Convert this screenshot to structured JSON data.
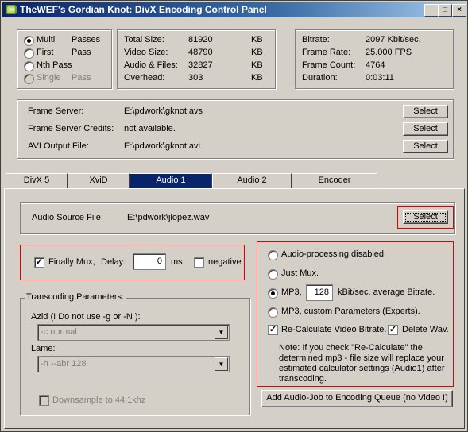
{
  "window": {
    "title": "TheWEF's Gordian Knot:  DivX Encoding Control Panel"
  },
  "passes": {
    "items": [
      {
        "label_a": "Multi",
        "label_b": "Passes",
        "checked": true,
        "enabled": true
      },
      {
        "label_a": "First",
        "label_b": "Pass",
        "checked": false,
        "enabled": true
      },
      {
        "label_a": "Nth Pass",
        "label_b": "",
        "checked": false,
        "enabled": true
      },
      {
        "label_a": "Single",
        "label_b": "Pass",
        "checked": false,
        "enabled": false
      }
    ]
  },
  "sizes": {
    "rows": [
      {
        "label": "Total Size:",
        "value": "81920",
        "unit": "KB"
      },
      {
        "label": "Video Size:",
        "value": "48790",
        "unit": "KB"
      },
      {
        "label": "Audio & Files:",
        "value": "32827",
        "unit": "KB"
      },
      {
        "label": "Overhead:",
        "value": "303",
        "unit": "KB"
      }
    ]
  },
  "stats": {
    "rows": [
      {
        "label": "Bitrate:",
        "value": "2097 Kbit/sec."
      },
      {
        "label": "Frame Rate:",
        "value": "25.000 FPS"
      },
      {
        "label": "Frame Count:",
        "value": "4764"
      },
      {
        "label": "Duration:",
        "value": "0:03:11"
      }
    ]
  },
  "files": {
    "select_label": "Select",
    "rows": [
      {
        "label": "Frame Server:",
        "value": "E:\\pdwork\\gknot.avs"
      },
      {
        "label": "Frame Server Credits:",
        "value": "not available."
      },
      {
        "label": "AVI Output File:",
        "value": "E:\\pdwork\\gknot.avi"
      }
    ]
  },
  "tabs": [
    "DivX 5",
    "XviD",
    "Audio 1",
    "Audio 2",
    "Encoder"
  ],
  "active_tab": "Audio 1",
  "audio": {
    "source_label": "Audio Source File:",
    "source_value": "E:\\pdwork\\jlopez.wav",
    "select_label": "Select",
    "finally_mux_label": "Finally Mux,",
    "finally_mux_checked": true,
    "delay_label": "Delay:",
    "delay_value": "0",
    "delay_unit": "ms",
    "negative_label": "negative",
    "negative_checked": false,
    "transcoding": {
      "title": "Transcoding Parameters:",
      "azid_label": "Azid (! Do not use -g or -N ):",
      "azid_value": "-c normal",
      "lame_label": "Lame:",
      "lame_value": "-h --abr 128",
      "downsample_label": "Downsample to 44.1khz",
      "downsample_checked": false
    },
    "options": {
      "disabled_label": "Audio-processing disabled.",
      "just_mux_label": "Just Mux.",
      "mp3_label": "MP3,",
      "mp3_bitrate": "128",
      "mp3_bitrate_suffix": "kBit/sec. average Bitrate.",
      "mp3_custom_label": "MP3, custom Parameters (Experts).",
      "selected": "mp3",
      "recalc_label": "Re-Calculate Video Bitrate.",
      "recalc_checked": true,
      "delete_wav_label": "Delete Wav.",
      "delete_wav_checked": true,
      "note_lines": [
        "Note: If you check \"Re-Calculate\" the",
        "determined mp3 - file size will replace your",
        "estimated calculator settings (Audio1) after",
        "transcoding."
      ]
    },
    "add_job_label": "Add Audio-Job to Encoding Queue (no Video !)"
  }
}
